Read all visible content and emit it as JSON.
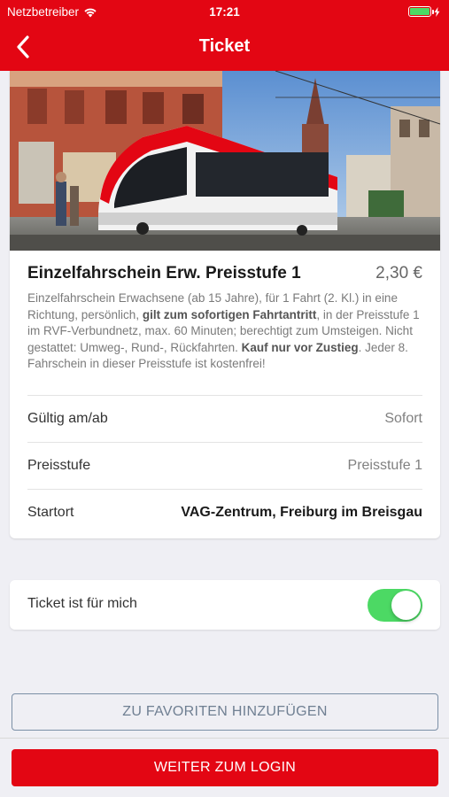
{
  "status_bar": {
    "carrier": "Netzbetreiber",
    "time": "17:21",
    "battery_level": 1.0
  },
  "nav": {
    "title": "Ticket",
    "back_icon": "chevron-left-icon"
  },
  "ticket": {
    "title": "Einzelfahrschein Erw. Preisstufe 1",
    "price": "2,30 €",
    "description": {
      "part1": "Einzelfahrschein Erwachsene (ab 15 Jahre), für 1 Fahrt (2. Kl.) in eine Richtung, persönlich, ",
      "bold1": "gilt zum sofortigen Fahrtantritt",
      "part2": ", in der Preisstufe 1 im RVF-Verbundnetz, max. 60 Minuten; berechtigt zum Umsteigen. Nicht gestattet: Umweg-, Rund-, Rückfahrten. ",
      "bold2": "Kauf nur vor Zustieg",
      "part3": ". Jeder 8. Fahrschein in dieser Preisstufe ist kostenfrei!"
    },
    "details": [
      {
        "label": "Gültig am/ab",
        "value": "Sofort"
      },
      {
        "label": "Preisstufe",
        "value": "Preisstufe 1"
      },
      {
        "label": "Startort",
        "value": "VAG-Zentrum, Freiburg im Breisgau"
      }
    ]
  },
  "toggle": {
    "label": "Ticket ist für mich",
    "on": true
  },
  "buttons": {
    "favorites": "ZU FAVORITEN HINZUFÜGEN",
    "login": "WEITER ZUM LOGIN"
  },
  "colors": {
    "brand_red": "#e30613",
    "toggle_green": "#4cd964",
    "background": "#efeff4"
  }
}
